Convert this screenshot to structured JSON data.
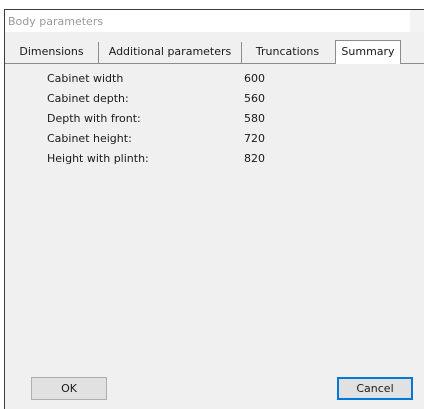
{
  "window": {
    "title": "Body parameters"
  },
  "tabs": [
    {
      "label": "Dimensions",
      "active": false
    },
    {
      "label": "Additional parameters",
      "active": false
    },
    {
      "label": "Truncations",
      "active": false
    },
    {
      "label": "Summary",
      "active": true
    }
  ],
  "summary": {
    "rows": [
      {
        "label": "Cabinet width",
        "value": "600"
      },
      {
        "label": "Cabinet depth:",
        "value": "560"
      },
      {
        "label": "Depth with front:",
        "value": "580"
      },
      {
        "label": "Cabinet height:",
        "value": "720"
      },
      {
        "label": "Height with plinth:",
        "value": "820"
      }
    ]
  },
  "buttons": {
    "ok_label": "OK",
    "cancel_label": "Cancel"
  },
  "colors": {
    "dialog_background": "#f0f0f0",
    "active_tab_background": "#ffffff",
    "default_button_border": "#0078d7",
    "title_text": "#9a9a9a"
  }
}
